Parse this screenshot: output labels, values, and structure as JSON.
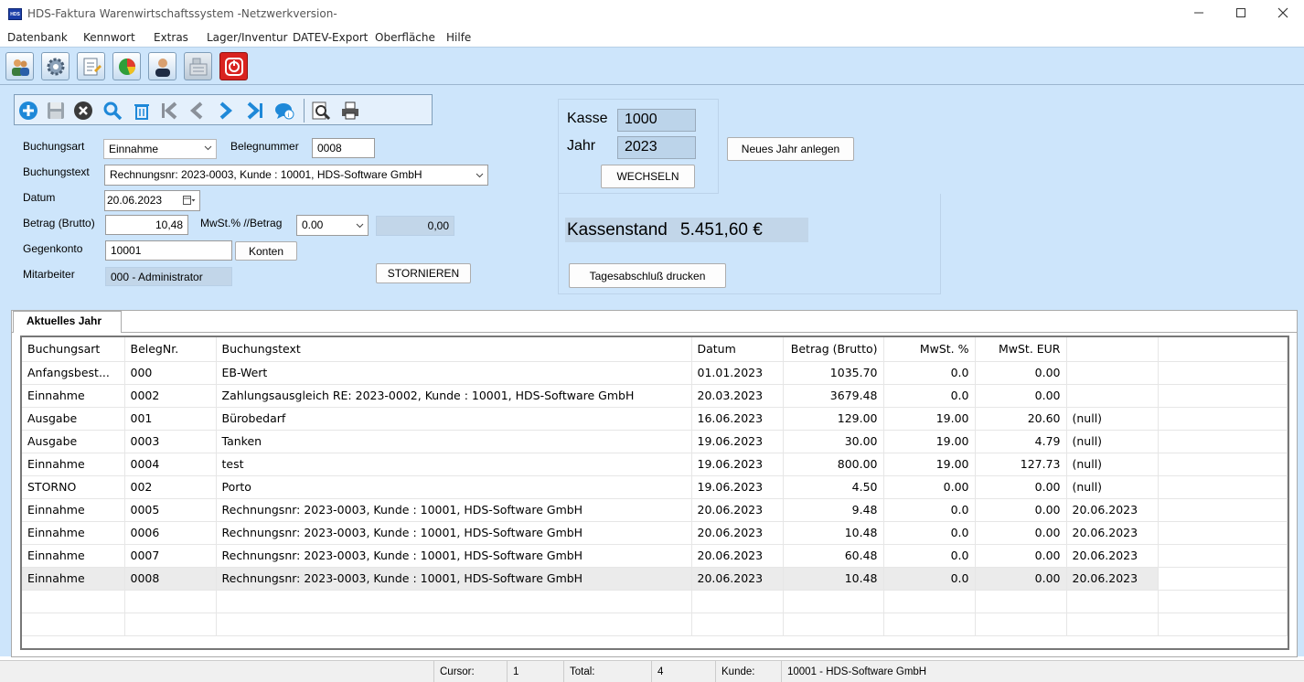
{
  "window": {
    "title": "HDS-Faktura Warenwirtschaftssystem -Netzwerkversion-",
    "app_icon_text": "HDS"
  },
  "menu": [
    "Datenbank",
    "Kennwort",
    "Extras",
    "Lager/Inventur",
    "DATEV-Export",
    "Oberfläche",
    "Hilfe"
  ],
  "form": {
    "buchungsart_label": "Buchungsart",
    "buchungsart_value": "Einnahme",
    "belegnummer_label": "Belegnummer",
    "belegnummer_value": "0008",
    "buchungstext_label": "Buchungstext",
    "buchungstext_value": "Rechnungsnr: 2023-0003, Kunde : 10001, HDS-Software GmbH",
    "datum_label": "Datum",
    "datum_value": "20.06.2023",
    "betrag_label": "Betrag (Brutto)",
    "betrag_value": "10,48",
    "mwst_label": "MwSt.% //Betrag",
    "mwst_value": "0.00",
    "mwst_betrag": "0,00",
    "gegenkonto_label": "Gegenkonto",
    "gegenkonto_value": "10001",
    "konten_button": "Konten",
    "mitarbeiter_label": "Mitarbeiter",
    "mitarbeiter_value": "000 - Administrator",
    "stornieren_button": "STORNIEREN"
  },
  "kasse": {
    "kasse_label": "Kasse",
    "kasse_value": "1000",
    "jahr_label": "Jahr",
    "jahr_value": "2023",
    "wechseln_button": "WECHSELN",
    "neues_jahr_button": "Neues Jahr anlegen",
    "kassenstand_label": "Kassenstand",
    "kassenstand_value": "5.451,60 €",
    "tagesabschluss_button": "Tagesabschluß drucken"
  },
  "tab": {
    "label": "Aktuelles Jahr"
  },
  "table": {
    "columns": [
      "Buchungsart",
      "BelegNr.",
      "Buchungstext",
      "Datum",
      "Betrag (Brutto)",
      "MwSt. %",
      "MwSt. EUR",
      ""
    ],
    "rows": [
      [
        "Anfangsbest...",
        "000",
        "EB-Wert",
        "01.01.2023",
        "1035.70",
        "0.0",
        "0.00",
        ""
      ],
      [
        "Einnahme",
        "0002",
        "Zahlungsausgleich RE: 2023-0002, Kunde : 10001, HDS-Software GmbH",
        "20.03.2023",
        "3679.48",
        "0.0",
        "0.00",
        ""
      ],
      [
        "Ausgabe",
        "001",
        "Bürobedarf",
        "16.06.2023",
        "129.00",
        "19.00",
        "20.60",
        "(null)"
      ],
      [
        "Ausgabe",
        "0003",
        "Tanken",
        "19.06.2023",
        "30.00",
        "19.00",
        "4.79",
        "(null)"
      ],
      [
        "Einnahme",
        "0004",
        "test",
        "19.06.2023",
        "800.00",
        "19.00",
        "127.73",
        "(null)"
      ],
      [
        "STORNO",
        "002",
        "Porto",
        "19.06.2023",
        "4.50",
        "0.00",
        "0.00",
        "(null)"
      ],
      [
        "Einnahme",
        "0005",
        "Rechnungsnr: 2023-0003, Kunde : 10001, HDS-Software GmbH",
        "20.06.2023",
        "9.48",
        "0.0",
        "0.00",
        "20.06.2023"
      ],
      [
        "Einnahme",
        "0006",
        "Rechnungsnr: 2023-0003, Kunde : 10001, HDS-Software GmbH",
        "20.06.2023",
        "10.48",
        "0.0",
        "0.00",
        "20.06.2023"
      ],
      [
        "Einnahme",
        "0007",
        "Rechnungsnr: 2023-0003, Kunde : 10001, HDS-Software GmbH",
        "20.06.2023",
        "60.48",
        "0.0",
        "0.00",
        "20.06.2023"
      ],
      [
        "Einnahme",
        "0008",
        "Rechnungsnr: 2023-0003, Kunde : 10001, HDS-Software GmbH",
        "20.06.2023",
        "10.48",
        "0.0",
        "0.00",
        "20.06.2023"
      ]
    ],
    "selected_row": 9
  },
  "status": {
    "cursor_label": "Cursor:",
    "cursor_value": "1",
    "total_label": "Total:",
    "total_value": "4",
    "kunde_label": "Kunde:",
    "kunde_value": "10001 - HDS-Software GmbH"
  },
  "colors": {
    "panel_bg": "#cde5fb",
    "accent_blue": "#1e88d8",
    "exit_red": "#d9231f"
  }
}
